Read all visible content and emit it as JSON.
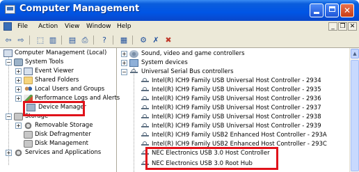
{
  "window": {
    "title": "Computer Management",
    "min_label": "",
    "max_label": "",
    "close_label": "✕"
  },
  "menu": {
    "items": [
      "File",
      "Action",
      "View",
      "Window",
      "Help"
    ],
    "mdi_minimize": "_",
    "mdi_restore": "❐",
    "mdi_close": "✕"
  },
  "toolbar": {
    "back": "⇦",
    "forward": "⇨",
    "up": "⬚",
    "show_hide": "▥",
    "properties": "▤",
    "print": "⎙",
    "help": "?",
    "scan": "▦",
    "disable": "✖",
    "uninstall": "✗",
    "driver": "⚙"
  },
  "left_tree": {
    "root": "Computer Management (Local)",
    "system_tools": "System Tools",
    "event_viewer": "Event Viewer",
    "shared_folders": "Shared Folders",
    "local_users": "Local Users and Groups",
    "performance": "Performance Logs and Alerts",
    "device_manager": "Device Manager",
    "storage": "Storage",
    "removable": "Removable Storage",
    "defrag": "Disk Defragmenter",
    "disk_mgmt": "Disk Management",
    "services": "Services and Applications"
  },
  "right_tree": {
    "sound": "Sound, video and game controllers",
    "system_devices": "System devices",
    "usb_controllers": "Universal Serial Bus controllers",
    "devices": [
      "Intel(R) ICH9 Family USB Universal Host Controller - 2934",
      "Intel(R) ICH9 Family USB Universal Host Controller - 2935",
      "Intel(R) ICH9 Family USB Universal Host Controller - 2936",
      "Intel(R) ICH9 Family USB Universal Host Controller - 2937",
      "Intel(R) ICH9 Family USB Universal Host Controller - 2938",
      "Intel(R) ICH9 Family USB Universal Host Controller - 2939",
      "Intel(R) ICH9 Family USB2 Enhanced Host Controller - 293A",
      "Intel(R) ICH9 Family USB2 Enhanced Host Controller - 293C",
      "NEC Electronics USB 3.0 Host Controller",
      "NEC Electronics USB 3.0 Root Hub"
    ]
  },
  "scrollbar": {
    "up_arrow": "▲"
  },
  "colors": {
    "titlebar": "#0055e5",
    "chrome": "#ece9d8",
    "highlight_box": "#e0121a"
  }
}
